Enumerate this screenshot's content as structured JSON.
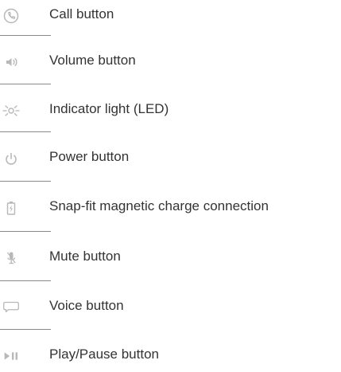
{
  "colors": {
    "text": "#333333",
    "icon": "#b8b8b8",
    "divider": "#8a8a8a"
  },
  "items": [
    {
      "icon": "phone-icon",
      "label": "Call button"
    },
    {
      "icon": "speaker-volume-icon",
      "label": "Volume button"
    },
    {
      "icon": "indicator-light-icon",
      "label": "Indicator light (LED)"
    },
    {
      "icon": "power-icon",
      "label": "Power button"
    },
    {
      "icon": "battery-charge-icon",
      "label": "Snap-fit magnetic charge connection"
    },
    {
      "icon": "microphone-mute-icon",
      "label": "Mute button"
    },
    {
      "icon": "speech-bubble-icon",
      "label": "Voice button"
    },
    {
      "icon": "play-pause-icon",
      "label": "Play/Pause button"
    }
  ]
}
